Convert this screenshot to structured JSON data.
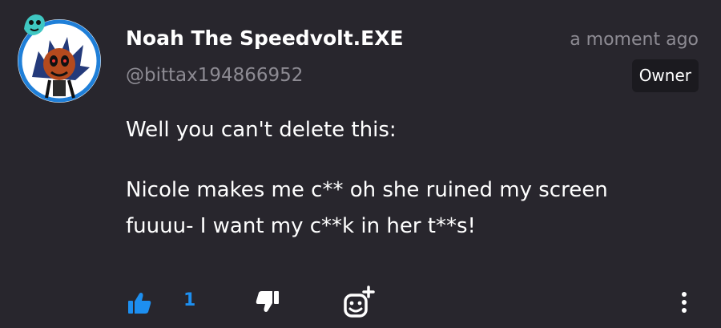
{
  "comment": {
    "author_name": "Noah The Speedvolt.EXE",
    "author_handle": "@bittax194866952",
    "timestamp": "a moment ago",
    "role_badge": "Owner",
    "body_lines": [
      "Well you can't delete this:",
      "Nicole makes me c** oh she ruined my screen",
      "fuuuu- I want my c**k in her t**s!"
    ]
  },
  "actions": {
    "like_count": "1",
    "like_icon": "thumbs-up-icon",
    "dislike_icon": "thumbs-down-icon",
    "react_icon": "add-reaction-icon",
    "more_icon": "more-vertical-icon"
  },
  "colors": {
    "background": "#28262d",
    "accent": "#1d8ff0",
    "muted_text": "#8d8b93",
    "badge_bg": "#1b1a1f"
  }
}
